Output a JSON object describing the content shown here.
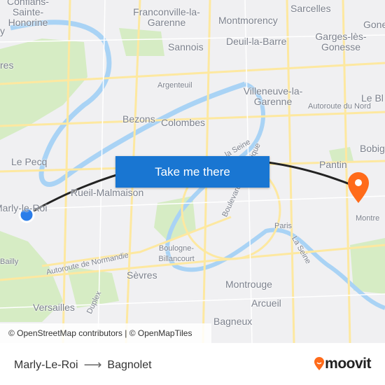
{
  "map": {
    "labels": [
      "Conflans-Sainte-Honorine",
      "Franconville-la-Garenne",
      "Sarcelles",
      "Montmorency",
      "Deuil-la-Barre",
      "Garges-lès-Gonesse",
      "Gone",
      "Sannois",
      "Argenteuil",
      "Villeneuve-la-Garenne",
      "Autoroute du Nord",
      "Le Bl",
      "Bezons",
      "Colombes",
      "Bobig",
      "Le Pecq",
      "Pantin",
      "Rueil-Malmaison",
      "Marly-le-Roi",
      "Montre",
      "Paris",
      "Boulogne-Billancourt",
      "Autoroute de Normandie",
      "Sèvres",
      "La Seine",
      "Montrouge",
      "Arcueil",
      "Versailles",
      "Bagneux",
      "Boulevard Périphérique",
      "la Seine",
      "Bailly",
      "res",
      "y",
      "Duplex"
    ],
    "colors": {
      "land": "#f0f0f2",
      "water": "#a9d3f5",
      "park": "#d6ecc4",
      "road": "#fde8a0",
      "route": "#222222",
      "origin": "#2b7de9",
      "destination": "#ff6b1a"
    }
  },
  "cta": {
    "label": "Take me there"
  },
  "attribution": "© OpenStreetMap contributors | © OpenMapTiles",
  "footer": {
    "origin": "Marly-Le-Roi",
    "arrow": "⟶",
    "destination": "Bagnolet",
    "logo": "moovit"
  },
  "icons": {
    "origin": "origin-dot-icon",
    "destination": "destination-pin-icon",
    "logo": "moovit-pin-icon"
  }
}
